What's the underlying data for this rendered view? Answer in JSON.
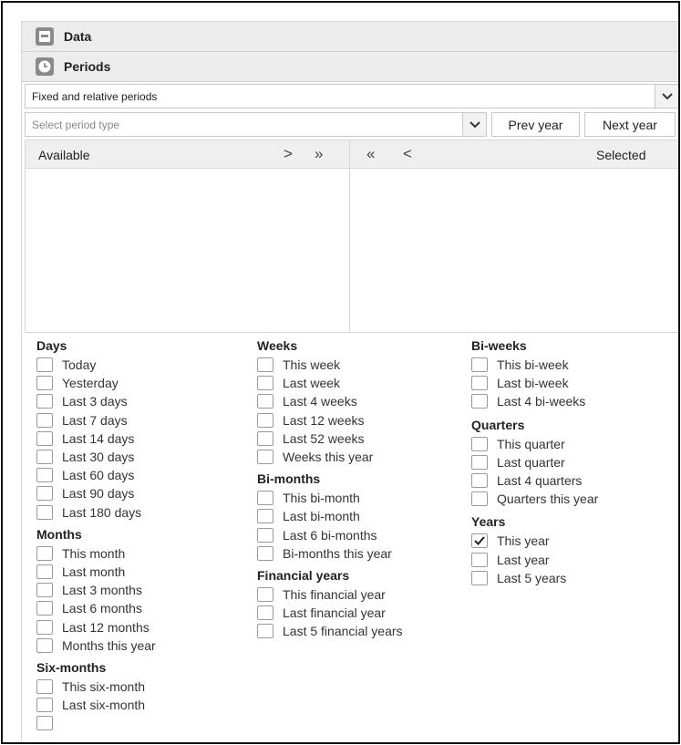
{
  "sections": {
    "data_label": "Data",
    "periods_label": "Periods"
  },
  "period_mode_select": {
    "value": "Fixed and relative periods"
  },
  "period_type_select": {
    "placeholder": "Select period type"
  },
  "buttons": {
    "prev_year": "Prev year",
    "next_year": "Next year"
  },
  "lists": {
    "available_label": "Available",
    "selected_label": "Selected"
  },
  "groups": {
    "days": {
      "label": "Days",
      "items": [
        "Today",
        "Yesterday",
        "Last 3 days",
        "Last 7 days",
        "Last 14 days",
        "Last 30 days",
        "Last 60 days",
        "Last 90 days",
        "Last 180 days"
      ]
    },
    "months": {
      "label": "Months",
      "items": [
        "This month",
        "Last month",
        "Last 3 months",
        "Last 6 months",
        "Last 12 months",
        "Months this year"
      ]
    },
    "six_months": {
      "label": "Six-months",
      "items": [
        "This six-month",
        "Last six-month"
      ]
    },
    "weeks": {
      "label": "Weeks",
      "items": [
        "This week",
        "Last week",
        "Last 4 weeks",
        "Last 12 weeks",
        "Last 52 weeks",
        "Weeks this year"
      ]
    },
    "bi_months": {
      "label": "Bi-months",
      "items": [
        "This bi-month",
        "Last bi-month",
        "Last 6 bi-months",
        "Bi-months this year"
      ]
    },
    "financial_years": {
      "label": "Financial years",
      "items": [
        "This financial year",
        "Last financial year",
        "Last 5 financial years"
      ]
    },
    "bi_weeks": {
      "label": "Bi-weeks",
      "items": [
        "This bi-week",
        "Last bi-week",
        "Last 4 bi-weeks"
      ]
    },
    "quarters": {
      "label": "Quarters",
      "items": [
        "This quarter",
        "Last quarter",
        "Last 4 quarters",
        "Quarters this year"
      ]
    },
    "years": {
      "label": "Years",
      "items": [
        "This year",
        "Last year",
        "Last 5 years"
      ],
      "checked": [
        "This year"
      ]
    }
  }
}
